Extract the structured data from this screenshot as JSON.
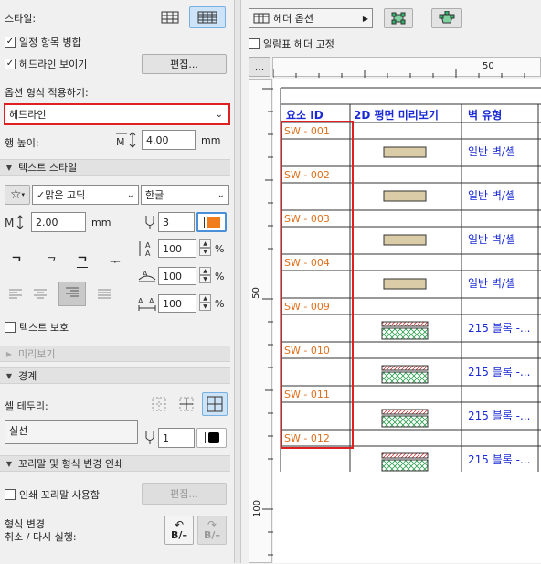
{
  "left": {
    "style_label": "스타일:",
    "merge_label": "일정 항목 병합",
    "headline_show_label": "헤드라인 보이기",
    "edit_button": "편집...",
    "apply_label": "옵션 형식 적용하기:",
    "apply_value": "헤드라인",
    "row_height_label": "행 높이:",
    "row_height_value": "4.00",
    "row_height_unit": "mm",
    "text_style_section": "텍스트 스타일",
    "font_value": "맑은 고딕",
    "lang_value": "한글",
    "font_size_value": "2.00",
    "font_size_unit": "mm",
    "pen_value": "3",
    "scale1": "100",
    "scale2": "100",
    "scale3": "100",
    "pct": "%",
    "protect_label": "텍스트 보호",
    "preview_section": "미리보기",
    "border_section": "경계",
    "cell_border_label": "셀 테두리:",
    "line_type": "실선",
    "border_pen": "1",
    "footer_section": "꼬리말 및 형식 변경 인쇄",
    "print_footer_label": "인쇄 꼬리말 사용함",
    "edit_button2": "편집...",
    "format_change_label": "형식 변경",
    "undo_redo_label": "취소 / 다시 실행:",
    "undo_text": "B/–",
    "redo_text": "B/–"
  },
  "right": {
    "header_option": "헤더 옵션",
    "fix_header_label": "일람표 헤더 고정",
    "ruler_button": "...",
    "ruler_50": "50",
    "vruler_50": "50",
    "vruler_100": "100",
    "headers": [
      "요소 ID",
      "2D 평면 미리보기",
      "벽 유형"
    ],
    "rows": [
      {
        "id": "SW - 001",
        "type": "일반 벽/셸",
        "kind": "plain"
      },
      {
        "id": "SW - 002",
        "type": "일반 벽/셸",
        "kind": "plain"
      },
      {
        "id": "SW - 003",
        "type": "일반 벽/셸",
        "kind": "plain"
      },
      {
        "id": "SW - 004",
        "type": "일반 벽/셸",
        "kind": "plain"
      },
      {
        "id": "SW - 009",
        "type": "215 블록 -...",
        "kind": "block"
      },
      {
        "id": "SW - 010",
        "type": "215 블록 -...",
        "kind": "block"
      },
      {
        "id": "SW - 011",
        "type": "215 블록 -...",
        "kind": "block"
      },
      {
        "id": "SW - 012",
        "type": "215 블록 -...",
        "kind": "block"
      }
    ]
  },
  "colors": {
    "highlight_red": "#e02020",
    "header_blue": "#1a2bd6",
    "id_orange": "#e0701e",
    "accent_orange": "#f07c1b",
    "wall_fill": "#d9cca7"
  }
}
